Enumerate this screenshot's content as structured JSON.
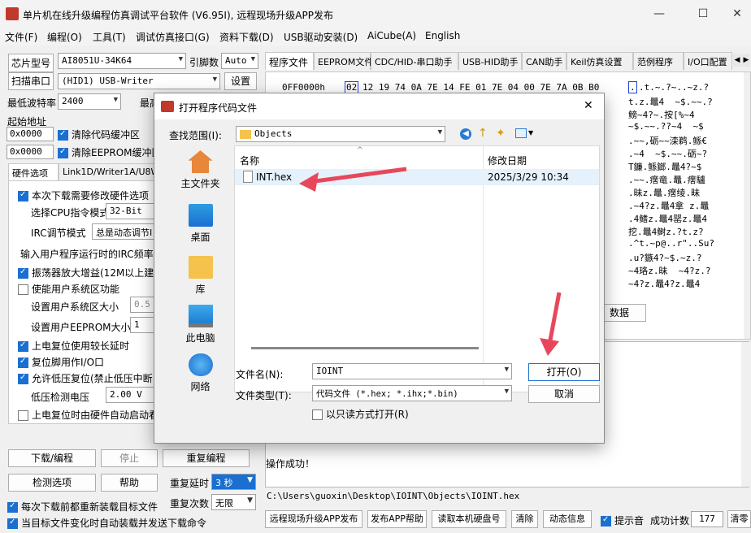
{
  "window": {
    "title": "单片机在线升级编程仿真调试平台软件 (V6.95I), 远程现场升级APP发布",
    "min": "—",
    "max": "☐",
    "close": "✕"
  },
  "menu": [
    "文件(F)",
    "编程(O)",
    "工具(T)",
    "调试仿真接口(G)",
    "资料下载(D)",
    "USB驱动安装(D)",
    "AiCube(A)",
    "English"
  ],
  "left": {
    "chip_label": "芯片型号",
    "chip_value": "AI8051U-34K64",
    "pins_label": "引脚数",
    "pins_value": "Auto",
    "scan_btn": "扫描串口",
    "port_value": "(HID1) USB-Writer",
    "settings_btn": "设置",
    "baud_label": "最低波特率",
    "baud_value": "2400",
    "baud_max_label": "最高",
    "start_addr_label": "起始地址",
    "addr1": "0x0000",
    "clear_code": "清除代码缓冲区",
    "addr2": "0x0000",
    "clear_eeprom": "清除EEPROM缓冲区",
    "tab_hw": "硬件选项",
    "tab_link": "Link1D/Writer1A/U8W",
    "opt_modify": "本次下载需要修改硬件选项",
    "cpu_mode_label": "选择CPU指令模式",
    "cpu_mode_value": "32-Bit",
    "irc_label": "IRC调节模式",
    "irc_value": "总是动态调节I",
    "irc_freq_label": "输入用户程序运行时的IRC频率",
    "opt_osc": "振荡器放大增益(12M以上建议",
    "opt_sys": "使能用户系统区功能",
    "sys_size_label": "设置用户系统区大小",
    "sys_size_value": "0.5",
    "eeprom_size_label": "设置用户EEPROM大小",
    "eeprom_size_value": "1",
    "opt_reset_delay": "上电复位使用较长延时",
    "opt_reset_io": "复位脚用作I/O口",
    "opt_lowv": "允许低压复位(禁止低压中断",
    "lowv_label": "低压检测电压",
    "lowv_value": "2.00 V",
    "opt_hw_start": "上电复位时由硬件自动启动看",
    "download_btn": "下载/编程",
    "stop_btn": "停止",
    "reprogram_btn": "重复编程",
    "check_btn": "检测选项",
    "help_btn": "帮助",
    "repeat_delay_label": "重复延时",
    "repeat_delay_value": "3 秒",
    "repeat_count_label": "重复次数",
    "repeat_count_value": "无限",
    "opt_reload": "每次下载前都重新装载目标文件",
    "opt_auto": "当目标文件变化时自动装载并发送下载命令"
  },
  "right": {
    "tabs": [
      "程序文件",
      "EEPROM文件",
      "CDC/HID-串口助手",
      "USB-HID助手",
      "CAN助手",
      "Keil仿真设置",
      "范例程序",
      "I/O口配置"
    ],
    "hex_addr": "0FF0000h",
    "hex_first": "02",
    "hex_bytes": "12 19 74 0A 7E 14 FE 01 7E 04 00 7E 7A 0B B0",
    "ascii_cursor": ".",
    "ascii_lines": [
      ".t.~.?~..~z.?",
      "t.z.鼂4  ~$.~~.?",
      "鳑~4?~.按[%~4",
      "~$.~~.??~4  ~$",
      ".~~,砺~~滦鹈.鲧€",
      ".~4  ~$.~~.砺~?",
      "T鐮.鲧鎯.鼂4?~$",
      ".~~.瘔竜.鼂.瘔驢",
      ".昧z.鼂.瘔绫.昧",
      ".~4?z.鼂4拿 z.鼂",
      ".4鳍z.鼂4罂z.鼂4",
      "挖.鼂4鲥z.?t.z?",
      ".^t.~p@..r\"..Su?",
      ".u?鏃4?~$.~z.?",
      "~4珞z.昧  ~4?z.?",
      "~4?z.鼂4?z.鼂4"
    ],
    "data_btn_fragment": "数据",
    "status_msg": "操作成功！",
    "path": "C:\\Users\\guoxin\\Desktop\\IOINT\\Objects\\IOINT.hex",
    "publish_btn": "远程现场升级APP发布",
    "publish_help_btn": "发布APP帮助",
    "read_serial_btn": "读取本机硬盘号",
    "clear_btn": "清除",
    "dynamic_btn": "动态信息",
    "sound_label": "提示音",
    "success_label": "成功计数",
    "success_value": "177",
    "clear2_btn": "清零"
  },
  "dialog": {
    "title": "打开程序代码文件",
    "close": "✕",
    "lookin_label": "查找范围(I):",
    "lookin_value": "Objects",
    "col_name": "名称",
    "col_date": "修改日期",
    "files": [
      {
        "name": "INT.hex",
        "date": "2025/3/29 10:34"
      }
    ],
    "places": [
      "主文件夹",
      "桌面",
      "库",
      "此电脑",
      "网络"
    ],
    "filename_label": "文件名(N):",
    "filename_value": "IOINT",
    "filetype_label": "文件类型(T):",
    "filetype_value": "代码文件 (*.hex;  *.ihx;*.bin)",
    "readonly_label": "以只读方式打开(R)",
    "open_btn": "打开(O)",
    "cancel_btn": "取消"
  },
  "colors": {
    "accent": "#1a6fd1",
    "arrow": "#e8475b"
  }
}
